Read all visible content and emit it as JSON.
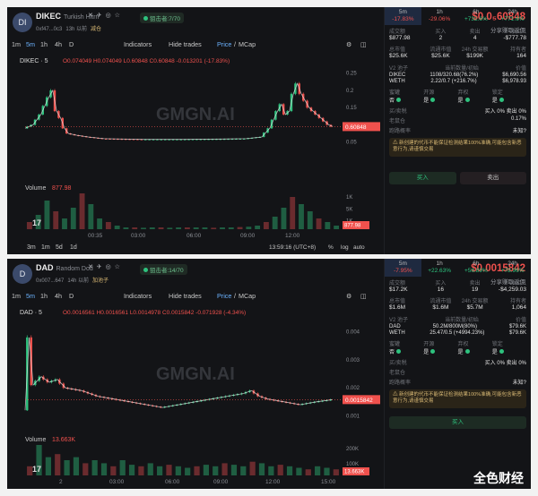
{
  "panels": [
    {
      "avatar_text": "DI",
      "symbol": "DIKEC",
      "full_name": "Turkish Hltrn",
      "age": "13h 以前",
      "address": "0xf47...0c3",
      "tag": "减仓",
      "snipers": "狙击者:7/70",
      "price": "$0.0₅60848",
      "price_sub": "分享赚取返佣",
      "toolbar": {
        "intervals": [
          "1m",
          "5m",
          "1h",
          "4h",
          "D"
        ],
        "active": "5m",
        "indicators": "Indicators",
        "hide_trades": "Hide trades",
        "price_label": "Price",
        "mcap_label": "MCap",
        "sep": "/"
      },
      "ohlc_label": "DIKEC · 5",
      "ohlc": "O0.074049 H0.074049 L0.60848 C0.60848 -0.013201 (-17.83%)",
      "watermark": "GMGN.AI",
      "volume_label": "Volume",
      "volume_value": "877.98",
      "range_buttons": [
        "3m",
        "1m",
        "5d",
        "1d"
      ],
      "time_display": "13:59:16 (UTC+8)",
      "scale_buttons": [
        "%",
        "log",
        "auto"
      ],
      "tabs": [
        {
          "label": "5m",
          "change": "-17.83%",
          "sign": "neg",
          "selected": true
        },
        {
          "label": "1h",
          "change": "-29.06%",
          "sign": "neg",
          "selected": false
        },
        {
          "label": "6h",
          "change": "+731.6%",
          "sign": "pos",
          "selected": false
        },
        {
          "label": "24h",
          "change": "+771.6%",
          "sign": "pos",
          "selected": false
        }
      ],
      "stats1": [
        {
          "label": "成交额",
          "value": "$877.98"
        },
        {
          "label": "买入",
          "value": "2"
        },
        {
          "label": "卖出",
          "value": "4"
        },
        {
          "label": "净买入",
          "value": "-$777.78"
        }
      ],
      "stats2": [
        {
          "label": "总市值",
          "value": "$25.6K"
        },
        {
          "label": "流通市值",
          "value": "$25.6K"
        },
        {
          "label": "24h 交易额",
          "value": "$199K"
        },
        {
          "label": "持有者",
          "value": "164"
        }
      ],
      "pool_title": "V2 池子",
      "pool_head": [
        "当前数量/初始",
        "价值"
      ],
      "pool_rows": [
        {
          "k": "DIKEC",
          "a": "1108/320.68(76.2%)",
          "v": "$6,690.56"
        },
        {
          "k": "WETH",
          "a": "2.22/0.7 (+216.7%)",
          "v": "$6,978.93"
        }
      ],
      "flags": [
        {
          "k": "蜜罐",
          "v": "否"
        },
        {
          "k": "开源",
          "v": "是"
        },
        {
          "k": "弃权",
          "v": "是"
        },
        {
          "k": "锁定",
          "v": "是"
        }
      ],
      "tax_label": "买/卖税",
      "tax_value": "买入 0%  卖出 0%",
      "holder_label": "老鼠仓",
      "holder_value": "0.17%",
      "risk_label": "跑路概率",
      "risk_value": "未知?",
      "warning": "新创建的代币不能保证检测结果100%准确,可能包含新恶意行为,请谨慎交易",
      "buy_label": "买入",
      "sell_label": "卖出",
      "brand": ""
    },
    {
      "avatar_text": "D",
      "symbol": "DAD",
      "full_name": "Random Dod",
      "age": "14h 以前",
      "address": "0x007...647",
      "tag": "加池子",
      "snipers": "狙击者:14/70",
      "price": "$0.0015842",
      "price_sub": "分享赚取返佣",
      "toolbar": {
        "intervals": [
          "1m",
          "5m",
          "1h",
          "4h",
          "D"
        ],
        "active": "5m",
        "indicators": "Indicators",
        "hide_trades": "Hide trades",
        "price_label": "Price",
        "mcap_label": "MCap",
        "sep": "/"
      },
      "ohlc_label": "DAD · 5",
      "ohlc": "O0.0016561 H0.0016561 L0.0014978 C0.0015842 -0.071928 (-4.34%)",
      "watermark": "GMGN.AI",
      "volume_label": "Volume",
      "volume_value": "13.663K",
      "range_buttons": [],
      "time_display": "",
      "scale_buttons": [],
      "tabs": [
        {
          "label": "5m",
          "change": "-7.95%",
          "sign": "neg",
          "selected": true
        },
        {
          "label": "1h",
          "change": "+22.63%",
          "sign": "pos",
          "selected": false
        },
        {
          "label": "6h",
          "change": "+56.89%",
          "sign": "pos",
          "selected": false
        },
        {
          "label": "24h",
          "change": "+78.96%",
          "sign": "pos",
          "selected": false
        }
      ],
      "stats1": [
        {
          "label": "成交额",
          "value": "$17.2K"
        },
        {
          "label": "买入",
          "value": "16"
        },
        {
          "label": "卖出",
          "value": "19"
        },
        {
          "label": "净买入",
          "value": "-$4,259.03"
        }
      ],
      "stats2": [
        {
          "label": "总市值",
          "value": "$1.6M"
        },
        {
          "label": "流通市值",
          "value": "$1.6M"
        },
        {
          "label": "24h 交易额",
          "value": "$5.7M"
        },
        {
          "label": "持有者",
          "value": "1,064"
        }
      ],
      "pool_title": "V2 池子",
      "pool_head": [
        "当前数量/初始",
        "价值"
      ],
      "pool_rows": [
        {
          "k": "DAD",
          "a": "50.2M/800M(80%)",
          "v": "$79.6K"
        },
        {
          "k": "WETH",
          "a": "25.47/0.5 (+4994.23%)",
          "v": "$79.6K"
        }
      ],
      "flags": [
        {
          "k": "蜜罐",
          "v": "否"
        },
        {
          "k": "开源",
          "v": "是"
        },
        {
          "k": "弃权",
          "v": "是"
        },
        {
          "k": "锁定",
          "v": "是"
        }
      ],
      "tax_label": "买/卖税",
      "tax_value": "买入 0%  卖出 0%",
      "holder_label": "老鼠仓",
      "holder_value": "",
      "risk_label": "跑路概率",
      "risk_value": "未知?",
      "warning": "新创建的代币不能保证检测结果100%准确,可能包含新恶意行为,请谨慎交易",
      "buy_label": "买入",
      "sell_label": "",
      "brand": "全色财经"
    }
  ],
  "colors": {
    "up": "#2ec27e",
    "down": "#f0514d",
    "line": "#e7e7e7",
    "bg": "#131417"
  },
  "chart_data": [
    {
      "type": "line",
      "title": "DIKEC · 5",
      "x_ticks": [
        "00:35",
        "03:00",
        "06:00",
        "09:00",
        "12:00"
      ],
      "y_ticks": [
        "0.25",
        "0.2",
        "0.15",
        "0.1",
        "0.05"
      ],
      "ylim": [
        0.0,
        0.27
      ],
      "price_path": [
        [
          0,
          0.09
        ],
        [
          2,
          0.1
        ],
        [
          4,
          0.13
        ],
        [
          6,
          0.18
        ],
        [
          7,
          0.2
        ],
        [
          8,
          0.14
        ],
        [
          9,
          0.12
        ],
        [
          10,
          0.09
        ],
        [
          11,
          0.075
        ],
        [
          13,
          0.07
        ],
        [
          16,
          0.065
        ],
        [
          20,
          0.06
        ],
        [
          30,
          0.058
        ],
        [
          40,
          0.058
        ],
        [
          50,
          0.059
        ],
        [
          56,
          0.06
        ],
        [
          60,
          0.065
        ],
        [
          62,
          0.09
        ],
        [
          64,
          0.14
        ],
        [
          65,
          0.16
        ],
        [
          66,
          0.13
        ],
        [
          67,
          0.14
        ],
        [
          68,
          0.19
        ],
        [
          69,
          0.22
        ],
        [
          70,
          0.19
        ],
        [
          71,
          0.17
        ],
        [
          72,
          0.15
        ],
        [
          74,
          0.13
        ],
        [
          76,
          0.11
        ],
        [
          77,
          0.1
        ],
        [
          78,
          0.095
        ]
      ],
      "last_price_label": "0.60848",
      "volume_ticks": [
        "1K",
        "5K",
        "1K"
      ],
      "volume": [
        0.2,
        0.4,
        0.8,
        0.5,
        0.3,
        0.6,
        1.0,
        0.7,
        0.3,
        0.2,
        0.1,
        0.05,
        0.05,
        0.04,
        0.05,
        0.05,
        0.04,
        0.05,
        0.05,
        0.05,
        0.05,
        0.04,
        0.05,
        0.05,
        0.06,
        0.07,
        0.1,
        0.2,
        0.35,
        0.6,
        0.9,
        0.7,
        0.5,
        0.3,
        0.2,
        0.1
      ]
    },
    {
      "type": "line",
      "title": "DAD · 5",
      "x_ticks": [
        "2",
        "03:00",
        "06:00",
        "09:00",
        "12:00",
        "15:00"
      ],
      "y_ticks": [
        "0.004",
        "0.003",
        "0.002",
        "0.001"
      ],
      "ylim": [
        0.0006,
        0.0045
      ],
      "price_path": [
        [
          0,
          0.0012
        ],
        [
          1,
          0.0038
        ],
        [
          2,
          0.0021
        ],
        [
          4,
          0.0024
        ],
        [
          6,
          0.0022
        ],
        [
          8,
          0.0023
        ],
        [
          10,
          0.002
        ],
        [
          14,
          0.0019
        ],
        [
          18,
          0.0017
        ],
        [
          22,
          0.0016
        ],
        [
          26,
          0.0015
        ],
        [
          30,
          0.0014
        ],
        [
          34,
          0.0013
        ],
        [
          38,
          0.0014
        ],
        [
          42,
          0.0015
        ],
        [
          46,
          0.0016
        ],
        [
          50,
          0.0017
        ],
        [
          54,
          0.0018
        ],
        [
          56,
          0.0019
        ],
        [
          58,
          0.0017
        ],
        [
          60,
          0.0016
        ],
        [
          64,
          0.0015
        ],
        [
          68,
          0.0014
        ],
        [
          72,
          0.0015
        ],
        [
          76,
          0.00158
        ]
      ],
      "last_price_label": "0.0015842",
      "volume_ticks": [
        "200K",
        "100K"
      ],
      "volume": [
        0.3,
        1.0,
        0.6,
        0.7,
        0.5,
        0.6,
        0.4,
        0.5,
        0.4,
        0.3,
        0.5,
        0.35,
        0.3,
        0.4,
        0.3,
        0.35,
        0.3,
        0.25,
        0.3,
        0.35,
        0.3,
        0.4,
        0.35,
        0.3,
        0.45,
        0.4,
        0.3,
        0.35,
        0.3,
        0.25,
        0.2,
        0.3,
        0.25,
        0.2
      ]
    }
  ]
}
